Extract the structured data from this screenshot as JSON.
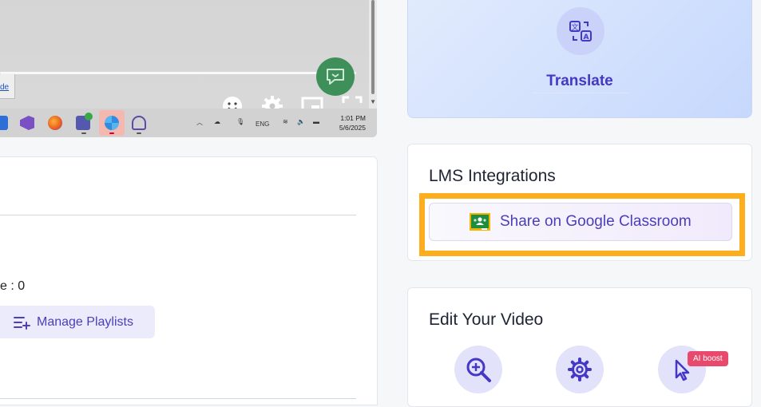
{
  "video": {
    "link_text": "de",
    "clock": {
      "time": "1:01 PM",
      "date": "5/6/2025"
    },
    "tray_language": "ENG",
    "icons": {
      "chat": "chat-bubble-icon",
      "emoji": "smiley-icon",
      "settings": "gear-icon",
      "pip": "picture-in-picture-icon",
      "fullscreen": "fullscreen-icon"
    }
  },
  "left_card": {
    "count_text": "e : 0",
    "manage_playlists_label": "Manage Playlists",
    "manage_playlists_icon": "playlist-add-icon"
  },
  "translate": {
    "label": "Translate",
    "icon": "translate-icon"
  },
  "lms": {
    "title": "LMS Integrations",
    "classroom_button_label": "Share on Google Classroom",
    "classroom_icon": "google-classroom-icon",
    "highlight_color": "#fcae1e"
  },
  "edit": {
    "title": "Edit Your Video",
    "ai_badge": "AI boost",
    "tools": [
      "zoom-icon",
      "gear-icon",
      "cursor-icon"
    ]
  },
  "colors": {
    "accent": "#4a3fb8",
    "translate_bg": "#c6d8fd",
    "badge": "#e84a6d",
    "chat_green": "#3f8f5a"
  }
}
